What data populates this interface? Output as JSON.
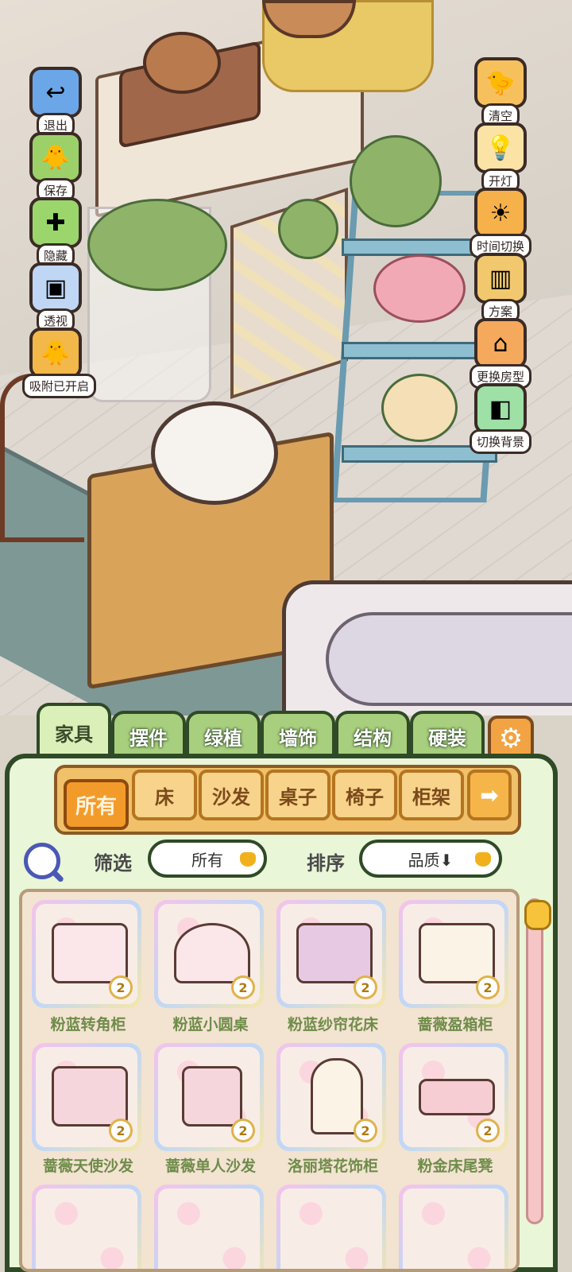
{
  "side_buttons_left": [
    {
      "label": "退出",
      "icon": "exit-arrow-icon"
    },
    {
      "label": "保存",
      "icon": "duck-save-icon"
    },
    {
      "label": "隐藏",
      "icon": "puzzle-hide-icon"
    },
    {
      "label": "透视",
      "icon": "cube-perspective-icon"
    },
    {
      "label": "吸附已开启",
      "icon": "duck-magnet-icon"
    }
  ],
  "side_buttons_right": [
    {
      "label": "清空",
      "icon": "duck-clear-icon"
    },
    {
      "label": "开灯",
      "icon": "lamp-icon"
    },
    {
      "label": "时间切换",
      "icon": "sun-moon-icon"
    },
    {
      "label": "方案",
      "icon": "plan-folder-icon"
    },
    {
      "label": "更换房型",
      "icon": "house-icon"
    },
    {
      "label": "切换背景",
      "icon": "background-icon"
    }
  ],
  "tabs": [
    "家具",
    "摆件",
    "绿植",
    "墙饰",
    "结构",
    "硬装"
  ],
  "active_tab": "家具",
  "categories": [
    "所有",
    "床",
    "沙发",
    "桌子",
    "椅子",
    "柜架"
  ],
  "active_category": "所有",
  "filter": {
    "label": "筛选",
    "value": "所有"
  },
  "sort": {
    "label": "排序",
    "value": "品质⬇"
  },
  "items": [
    {
      "name": "粉蓝转角柜",
      "count": "2"
    },
    {
      "name": "粉蓝小圆桌",
      "count": "2"
    },
    {
      "name": "粉蓝纱帘花床",
      "count": "2"
    },
    {
      "name": "蔷薇盈箱柜",
      "count": "2"
    },
    {
      "name": "蔷薇天使沙发",
      "count": "2"
    },
    {
      "name": "蔷薇单人沙发",
      "count": "2"
    },
    {
      "name": "洛丽塔花饰柜",
      "count": "2"
    },
    {
      "name": "粉金床尾凳",
      "count": "2"
    }
  ],
  "colors": {
    "panel_green": "#e9f6d7",
    "border_green": "#2f4a26",
    "category_orange": "#f39b2a",
    "item_name": "#6f8c4a"
  }
}
